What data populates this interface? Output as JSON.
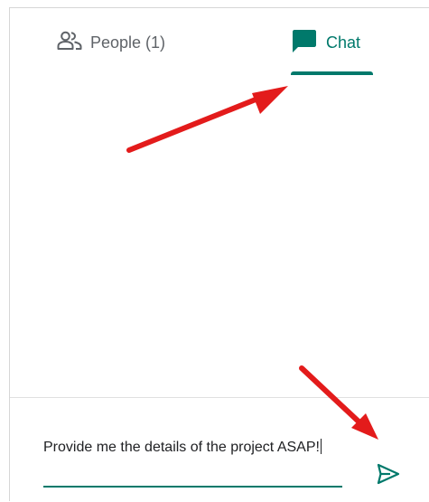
{
  "tabs": {
    "people": {
      "label": "People (1)",
      "icon": "people-icon"
    },
    "chat": {
      "label": "Chat",
      "icon": "chat-bubble-icon",
      "active": true
    }
  },
  "composer": {
    "input_value": "Provide me the details of the project ASAP!",
    "send_icon": "send-icon"
  },
  "annotations": [
    "red-arrow-to-chat-tab",
    "red-arrow-to-send-button"
  ],
  "colors": {
    "accent": "#00796b",
    "text_muted": "#5f6368",
    "annotation": "#e31b1b"
  }
}
